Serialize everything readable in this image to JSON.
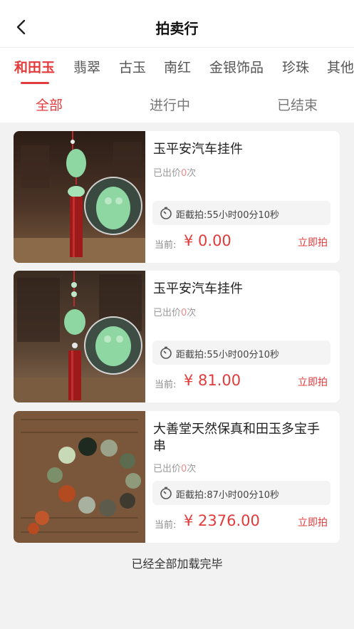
{
  "header": {
    "title": "拍卖行",
    "back_icon": "chevron-left-icon"
  },
  "categories": [
    {
      "label": "和田玉",
      "active": true
    },
    {
      "label": "翡翠",
      "active": false
    },
    {
      "label": "古玉",
      "active": false
    },
    {
      "label": "南红",
      "active": false
    },
    {
      "label": "金银饰品",
      "active": false
    },
    {
      "label": "珍珠",
      "active": false
    },
    {
      "label": "其他",
      "active": false
    }
  ],
  "status_tabs": [
    {
      "label": "全部",
      "active": true
    },
    {
      "label": "进行中",
      "active": false
    },
    {
      "label": "已结束",
      "active": false
    }
  ],
  "items": [
    {
      "title": "玉平安汽车挂件",
      "bid_prefix": "已出价",
      "bid_count": "0",
      "bid_suffix": "次",
      "countdown": "距截拍:55小时00分10秒",
      "price_label": "当前:",
      "price": "¥ 0.00",
      "action": "立即拍"
    },
    {
      "title": "玉平安汽车挂件",
      "bid_prefix": "已出价",
      "bid_count": "0",
      "bid_suffix": "次",
      "countdown": "距截拍:55小时00分10秒",
      "price_label": "当前:",
      "price": "¥ 81.00",
      "action": "立即拍"
    },
    {
      "title": "大善堂天然保真和田玉多宝手串",
      "bid_prefix": "已出价",
      "bid_count": "0",
      "bid_suffix": "次",
      "countdown": "距截拍:87小时00分10秒",
      "price_label": "当前:",
      "price": "¥ 2376.00",
      "action": "立即拍"
    }
  ],
  "footer": {
    "text": "已经全部加载完毕"
  },
  "colors": {
    "accent": "#e33b3b",
    "background": "#f2f2f2",
    "card": "#ffffff"
  }
}
